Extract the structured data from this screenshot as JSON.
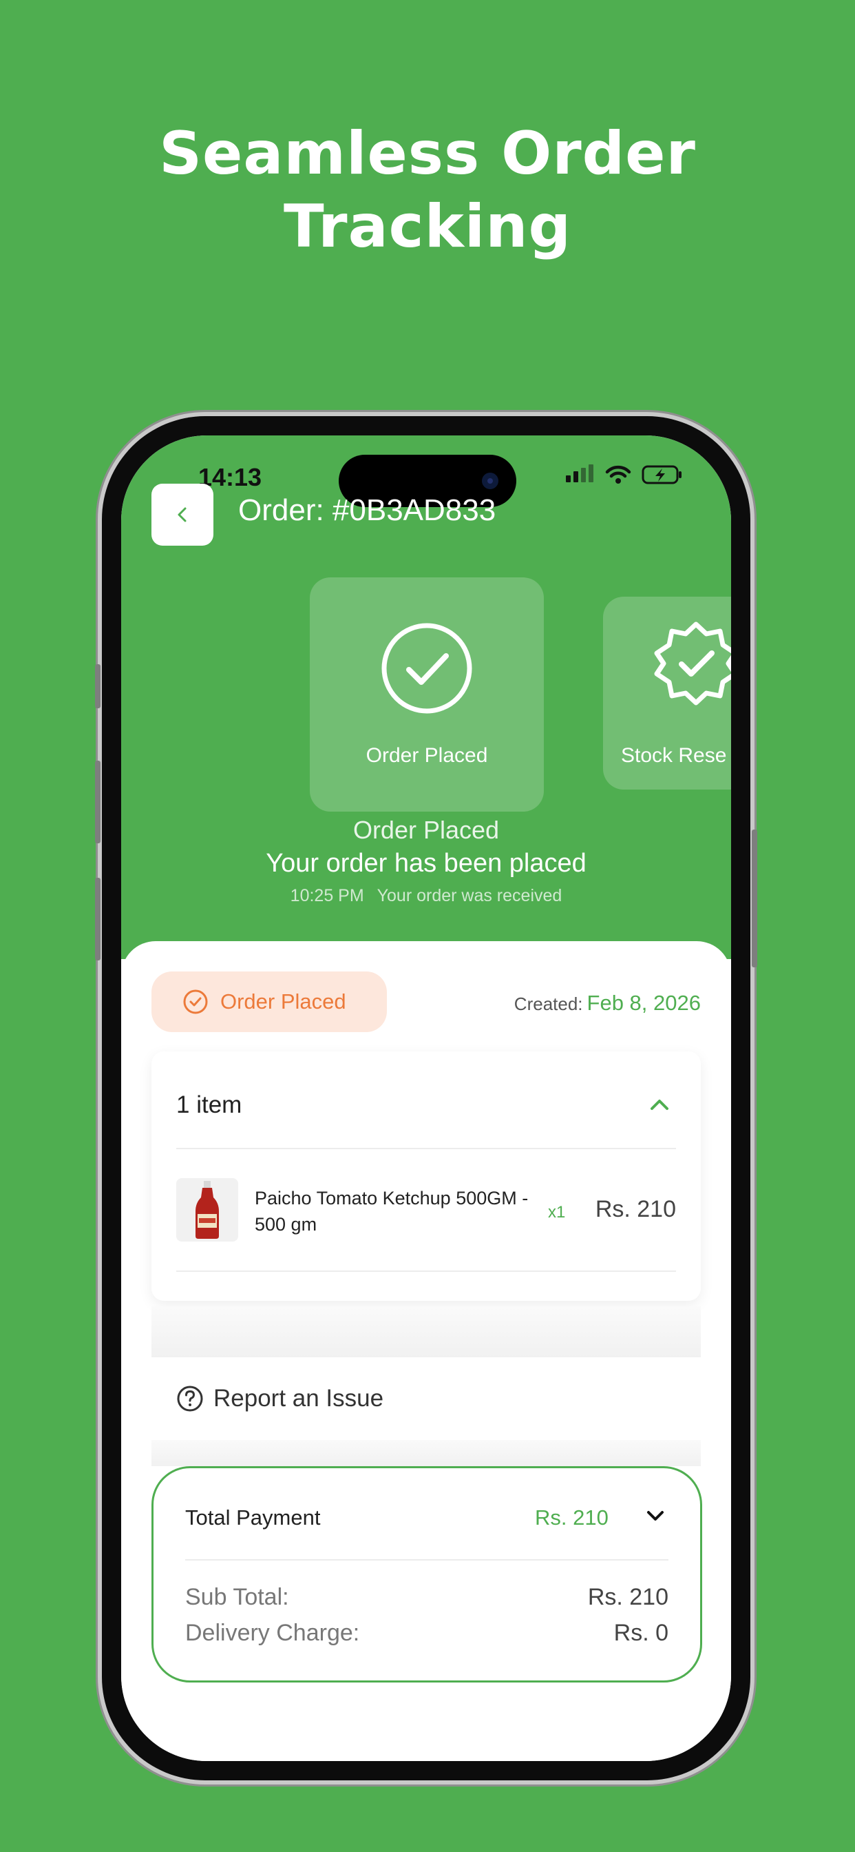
{
  "headline": {
    "line1": "Seamless Order",
    "line2": "Tracking"
  },
  "colors": {
    "brand_green": "#4fae50",
    "badge_bg": "#fde7dc",
    "badge_text": "#ec7a3a"
  },
  "status_bar": {
    "time": "14:13",
    "icons": [
      "signal-icon",
      "wifi-icon",
      "battery-charging-icon"
    ]
  },
  "header": {
    "back_icon": "chevron-left-icon",
    "title": "Order: #0B3AD833"
  },
  "steps": [
    {
      "label": "Order Placed",
      "icon": "check-circle-icon",
      "active": true
    },
    {
      "label": "Stock Rese",
      "icon": "badge-check-icon",
      "active": false
    }
  ],
  "current_status": {
    "title": "Order Placed",
    "description": "Your order has been placed",
    "time": "10:25 PM",
    "note": "Your order was received"
  },
  "order_badge": {
    "label": "Order Placed",
    "icon": "check-circle-icon"
  },
  "created": {
    "label": "Created:",
    "date": "Feb 8, 2026"
  },
  "items": {
    "count_label": "1 item",
    "list": [
      {
        "name": "Paicho Tomato Ketchup 500GM - 500 gm",
        "qty": "x1",
        "price": "Rs. 210"
      }
    ]
  },
  "report": {
    "label": "Report an Issue",
    "icon": "help-circle-icon"
  },
  "payment": {
    "label": "Total Payment",
    "total": "Rs. 210",
    "sub_total_label": "Sub Total:",
    "sub_total": "Rs. 210",
    "delivery_label": "Delivery Charge:",
    "delivery": "Rs. 0"
  }
}
